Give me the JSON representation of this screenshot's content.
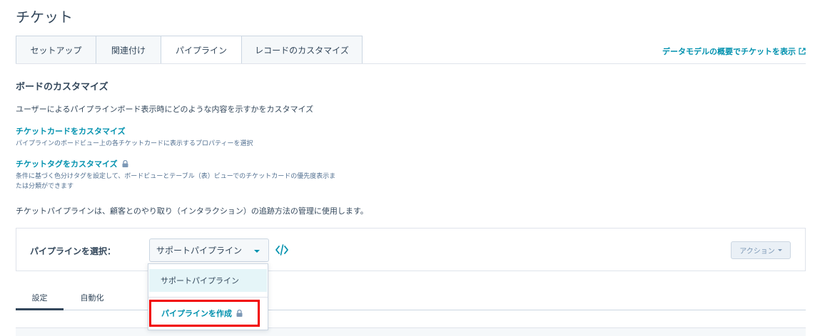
{
  "page": {
    "title": "チケット"
  },
  "tabs": [
    {
      "label": "セットアップ"
    },
    {
      "label": "関連付け"
    },
    {
      "label": "パイプライン"
    },
    {
      "label": "レコードのカスタマイズ"
    }
  ],
  "header_link": {
    "label": "データモデルの概要でチケットを表示",
    "icon": "external-link-icon"
  },
  "board": {
    "heading": "ボードのカスタマイズ",
    "description": "ユーザーによるパイプラインボード表示時にどのような内容を示すかをカスタマイズ",
    "card_link": {
      "title": "チケットカードをカスタマイズ",
      "subtitle": "パイプラインのボードビュー上の各チケットカードに表示するプロパティーを選択"
    },
    "tag_link": {
      "title": "チケットタグをカスタマイズ",
      "subtitle_line1": "条件に基づく色分けタグを設定して、ボードビューとテーブル（表）ビューでのチケットカードの優先度表示ま",
      "subtitle_line2": "たは分類ができます",
      "icon": "lock-icon"
    }
  },
  "pipeline_note": "チケットパイプラインは、顧客とのやり取り（インタラクション）の追跡方法の管理に使用します。",
  "pipeline_select": {
    "label": "パイプラインを選択：",
    "selected": "サポートパイプライン",
    "embed_icon": "code-embed-icon",
    "action_label": "アクション"
  },
  "dropdown": {
    "options": [
      "サポートパイプライン"
    ],
    "create_label": "パイプラインを作成"
  },
  "subtabs": [
    {
      "label": "設定"
    },
    {
      "label": "自動化"
    }
  ],
  "colors": {
    "link": "#0091ae",
    "text": "#33475b",
    "highlight_border": "#f20000",
    "dropdown_selected_bg": "#e5f5f8"
  }
}
